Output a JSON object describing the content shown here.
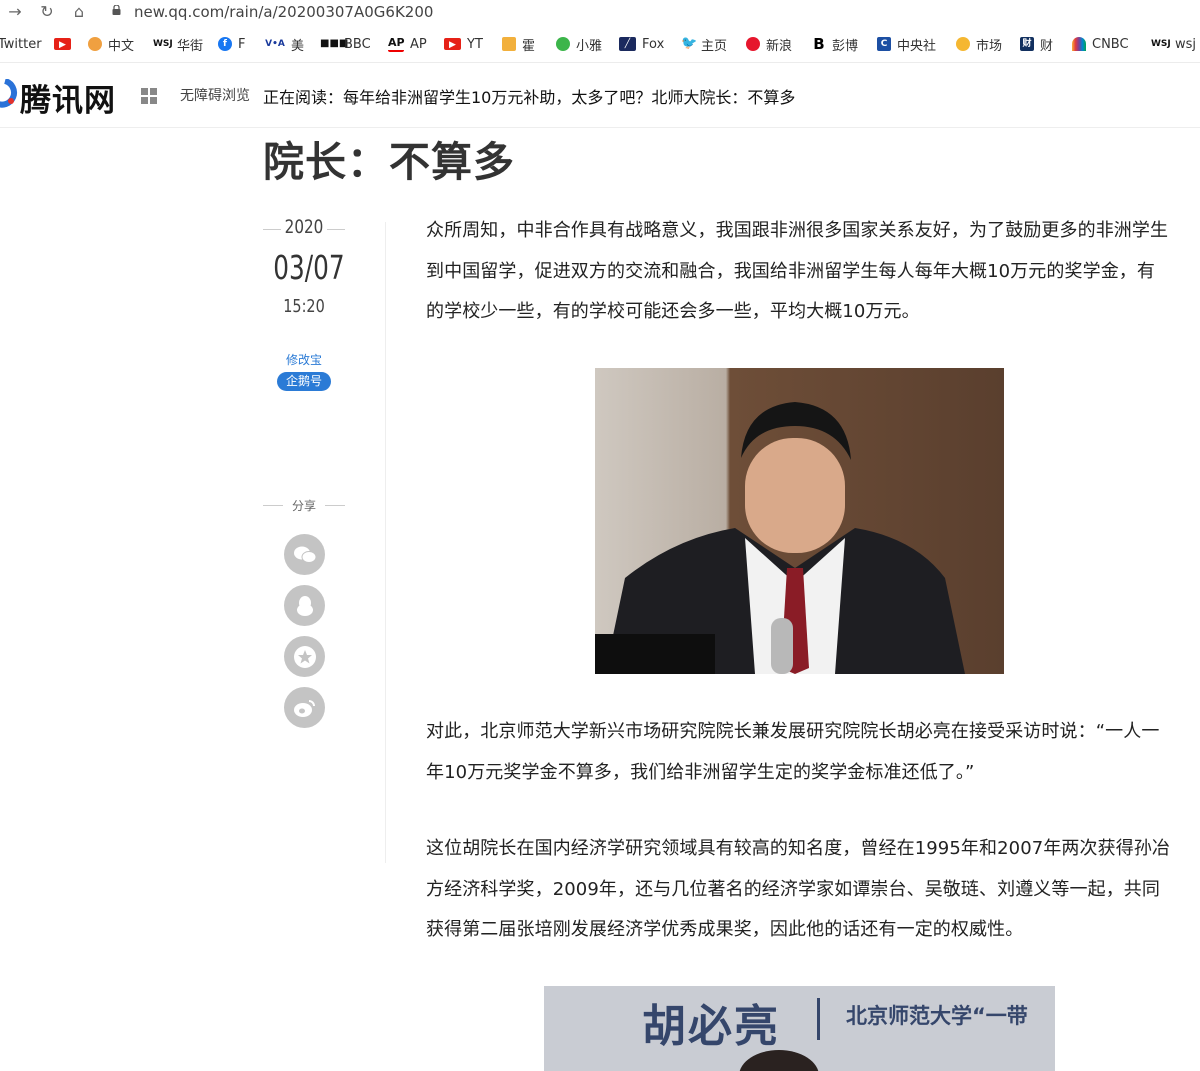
{
  "browser": {
    "url": "new.qq.com/rain/a/20200307A0G6K200",
    "bookmarks": [
      {
        "label": "Twitter",
        "icon": "twitter-text"
      },
      {
        "label": "",
        "icon": "youtube-icon"
      },
      {
        "label": "中文",
        "icon": "sun-icon"
      },
      {
        "label": "华街",
        "icon": "wsj-icon"
      },
      {
        "label": "F",
        "icon": "facebook-icon"
      },
      {
        "label": "美",
        "icon": "voa-icon"
      },
      {
        "label": "BBC",
        "icon": "bbc-icon"
      },
      {
        "label": "AP",
        "icon": "ap-icon"
      },
      {
        "label": "YT",
        "icon": "youtube-icon"
      },
      {
        "label": "霍",
        "icon": "app-icon"
      },
      {
        "label": "小雅",
        "icon": "leaf-icon"
      },
      {
        "label": "Fox",
        "icon": "fox-icon"
      },
      {
        "label": "主页",
        "icon": "twitter-icon"
      },
      {
        "label": "新浪",
        "icon": "weibo-icon"
      },
      {
        "label": "彭博",
        "icon": "bloomberg-icon"
      },
      {
        "label": "中央社",
        "icon": "cna-icon"
      },
      {
        "label": "市场",
        "icon": "market-icon"
      },
      {
        "label": "财",
        "icon": "caixin-icon"
      },
      {
        "label": "CNBC",
        "icon": "cnbc-icon"
      },
      {
        "label": "wsj",
        "icon": "wsj-icon"
      }
    ]
  },
  "header": {
    "logo": "腾讯网",
    "accessibility": "无障碍浏览",
    "now_reading": "正在阅读：每年给非洲留学生10万元补助，太多了吧？北师大院长：不算多"
  },
  "article": {
    "title_visible": "院长：不算多",
    "year": "2020",
    "date": "03/07",
    "time": "15:20",
    "author": "修改宝",
    "author_badge": "企鹅号",
    "share_label": "分享",
    "paragraphs": [
      "众所周知，中非合作具有战略意义，我国跟非洲很多国家关系友好，为了鼓励更多的非洲学生到中国留学，促进双方的交流和融合，我国给非洲留学生每人每年大概10万元的奖学金，有的学校少一些，有的学校可能还会多一些，平均大概10万元。",
      "对此，北京师范大学新兴市场研究院院长兼发展研究院院长胡必亮在接受采访时说：“一人一年10万元奖学金不算多，我们给非洲留学生定的奖学金标准还低了。”",
      "这位胡院长在国内经济学研究领域具有较高的知名度，曾经在1995年和2007年两次获得孙冶方经济科学奖，2009年，还与几位著名的经济学家如谭崇台、吴敬琏、刘遵义等一起，共同获得第二届张培刚发展经济学优秀成果奖，因此他的话还有一定的权威性。"
    ],
    "photo2_name": "胡必亮",
    "photo2_sub": "北京师范大学“一带"
  },
  "colors": {
    "accent": "#2b7bd6",
    "share_bg": "#c4c4c4"
  }
}
